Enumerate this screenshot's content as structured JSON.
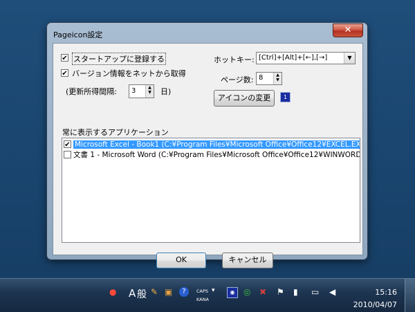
{
  "window": {
    "title": "Pageicon設定",
    "close_label": "✕"
  },
  "options": {
    "startup_label": "スタートアップに登録する",
    "startup_checked": true,
    "version_net_label": "バージョン情報をネットから取得",
    "version_net_checked": true,
    "interval_prefix": "(更新所得間隔:",
    "interval_value": "3",
    "interval_suffix": "日)"
  },
  "hotkey": {
    "label": "ホットキー:",
    "value": "[Ctrl]+[Alt]+[←],[→]"
  },
  "pages": {
    "label": "ページ数:",
    "value": "8"
  },
  "icon_change": {
    "button_label": "アイコンの変更",
    "icon_preview": "1"
  },
  "apps": {
    "header": "常に表示するアプリケーション",
    "items": [
      {
        "label": "Microsoft Excel - Book1 (C:¥Program Files¥Microsoft Office¥Office12¥EXCEL.EX",
        "checked": true,
        "selected": true
      },
      {
        "label": "文書 1 - Microsoft Word (C:¥Program Files¥Microsoft Office¥Office12¥WINWORD",
        "checked": false,
        "selected": false
      }
    ]
  },
  "buttons": {
    "ok": "OK",
    "cancel": "キャンセル"
  },
  "taskbar": {
    "ime_a": "A",
    "ime_kan": "般",
    "caps": "CAPS",
    "kana": "KANA",
    "time": "15:16",
    "date": "2010/04/07"
  }
}
